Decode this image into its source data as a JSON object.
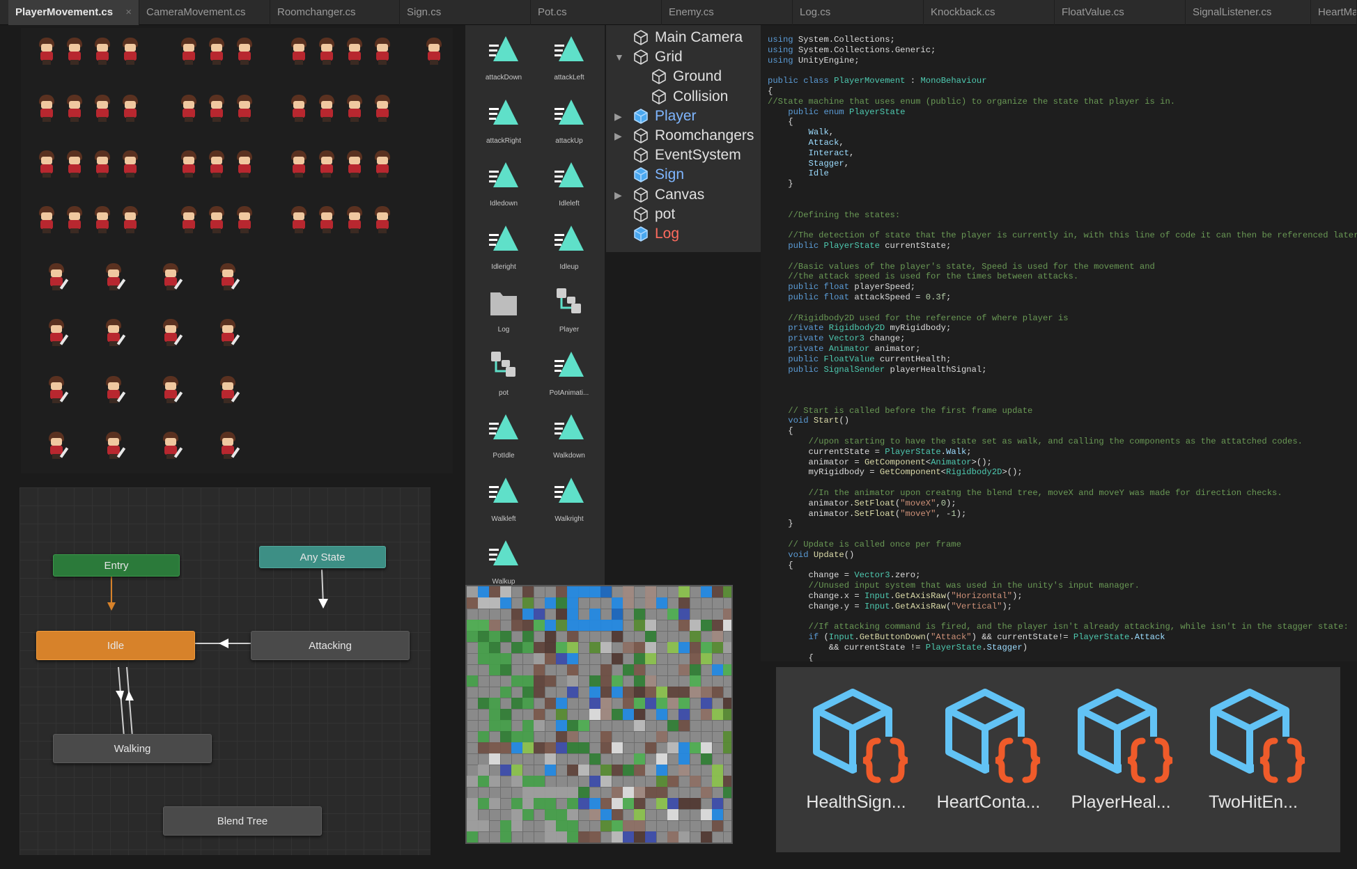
{
  "tabs": [
    {
      "label": "PlayerMovement.cs",
      "active": true,
      "close": "×"
    },
    {
      "label": "CameraMovement.cs"
    },
    {
      "label": "Roomchanger.cs"
    },
    {
      "label": "Sign.cs"
    },
    {
      "label": "Pot.cs"
    },
    {
      "label": "Enemy.cs"
    },
    {
      "label": "Log.cs"
    },
    {
      "label": "Knockback.cs"
    },
    {
      "label": "FloatValue.cs"
    },
    {
      "label": "SignalListener.cs"
    },
    {
      "label": "HeartMa"
    }
  ],
  "animator": {
    "entry": "Entry",
    "any_state": "Any State",
    "idle": "Idle",
    "attacking": "Attacking",
    "walking": "Walking",
    "blend_tree": "Blend Tree"
  },
  "assets": [
    {
      "label": "attackDown",
      "icon": "animation-clip-icon"
    },
    {
      "label": "attackLeft",
      "icon": "animation-clip-icon"
    },
    {
      "label": "attackRight",
      "icon": "animation-clip-icon"
    },
    {
      "label": "attackUp",
      "icon": "animation-clip-icon"
    },
    {
      "label": "Idledown",
      "icon": "animation-clip-icon"
    },
    {
      "label": "Idleleft",
      "icon": "animation-clip-icon"
    },
    {
      "label": "Idleright",
      "icon": "animation-clip-icon"
    },
    {
      "label": "Idleup",
      "icon": "animation-clip-icon"
    },
    {
      "label": "Log",
      "icon": "folder-icon"
    },
    {
      "label": "Player",
      "icon": "animator-controller-icon"
    },
    {
      "label": "pot",
      "icon": "animator-controller-icon"
    },
    {
      "label": "PotAnimati...",
      "icon": "animation-clip-icon"
    },
    {
      "label": "PotIdle",
      "icon": "animation-clip-icon"
    },
    {
      "label": "Walkdown",
      "icon": "animation-clip-icon"
    },
    {
      "label": "Walkleft",
      "icon": "animation-clip-icon"
    },
    {
      "label": "Walkright",
      "icon": "animation-clip-icon"
    },
    {
      "label": "Walkup",
      "icon": "animation-clip-icon"
    }
  ],
  "hierarchy": [
    {
      "label": "Main Camera",
      "indent": 0,
      "expand": "",
      "style": "normal"
    },
    {
      "label": "Grid",
      "indent": 0,
      "expand": "▼",
      "style": "normal"
    },
    {
      "label": "Ground",
      "indent": 1,
      "expand": "",
      "style": "normal"
    },
    {
      "label": "Collision",
      "indent": 1,
      "expand": "",
      "style": "normal"
    },
    {
      "label": "Player",
      "indent": 0,
      "expand": "▶",
      "style": "blue"
    },
    {
      "label": "Roomchangers",
      "indent": 0,
      "expand": "▶",
      "style": "normal"
    },
    {
      "label": "EventSystem",
      "indent": 0,
      "expand": "",
      "style": "normal"
    },
    {
      "label": "Sign",
      "indent": 0,
      "expand": "",
      "style": "blue"
    },
    {
      "label": "Canvas",
      "indent": 0,
      "expand": "▶",
      "style": "normal"
    },
    {
      "label": "pot",
      "indent": 0,
      "expand": "",
      "style": "normal"
    },
    {
      "label": "Log",
      "indent": 0,
      "expand": "",
      "style": "red"
    }
  ],
  "code": {
    "lines": [
      [
        [
          "k",
          "using"
        ],
        [
          "p",
          " System.Collections;"
        ]
      ],
      [
        [
          "k",
          "using"
        ],
        [
          "p",
          " System.Collections.Generic;"
        ]
      ],
      [
        [
          "k",
          "using"
        ],
        [
          "p",
          " UnityEngine;"
        ]
      ],
      [],
      [
        [
          "k",
          "public class "
        ],
        [
          "t",
          "PlayerMovement"
        ],
        [
          "p",
          " : "
        ],
        [
          "t",
          "MonoBehaviour"
        ]
      ],
      [
        [
          "p",
          "{"
        ]
      ],
      [
        [
          "c",
          "//State machine that uses enum (public) to organize the state that player is in."
        ]
      ],
      [
        [
          "p",
          "    "
        ],
        [
          "k",
          "public enum "
        ],
        [
          "t",
          "PlayerState"
        ]
      ],
      [
        [
          "p",
          "    {"
        ]
      ],
      [
        [
          "p",
          "        "
        ],
        [
          "v",
          "Walk"
        ],
        [
          "p",
          ","
        ]
      ],
      [
        [
          "p",
          "        "
        ],
        [
          "v",
          "Attack"
        ],
        [
          "p",
          ","
        ]
      ],
      [
        [
          "p",
          "        "
        ],
        [
          "v",
          "Interact"
        ],
        [
          "p",
          ","
        ]
      ],
      [
        [
          "p",
          "        "
        ],
        [
          "v",
          "Stagger"
        ],
        [
          "p",
          ","
        ]
      ],
      [
        [
          "p",
          "        "
        ],
        [
          "v",
          "Idle"
        ]
      ],
      [
        [
          "p",
          "    }"
        ]
      ],
      [],
      [],
      [
        [
          "p",
          "    "
        ],
        [
          "c",
          "//Defining the states:"
        ]
      ],
      [],
      [
        [
          "p",
          "    "
        ],
        [
          "c",
          "//The detection of state that the player is currently in, with this line of code it can then be referenced later."
        ]
      ],
      [
        [
          "p",
          "    "
        ],
        [
          "k",
          "public "
        ],
        [
          "t",
          "PlayerState"
        ],
        [
          "p",
          " currentState;"
        ]
      ],
      [],
      [
        [
          "p",
          "    "
        ],
        [
          "c",
          "//Basic values of the player's state, Speed is used for the movement and"
        ]
      ],
      [
        [
          "p",
          "    "
        ],
        [
          "c",
          "//the attack speed is used for the times between attacks."
        ]
      ],
      [
        [
          "p",
          "    "
        ],
        [
          "k",
          "public float"
        ],
        [
          "p",
          " playerSpeed;"
        ]
      ],
      [
        [
          "p",
          "    "
        ],
        [
          "k",
          "public float"
        ],
        [
          "p",
          " attackSpeed = "
        ],
        [
          "n",
          "0.3f"
        ],
        [
          "p",
          ";"
        ]
      ],
      [],
      [
        [
          "p",
          "    "
        ],
        [
          "c",
          "//Rigidbody2D used for the reference of where player is"
        ]
      ],
      [
        [
          "p",
          "    "
        ],
        [
          "k",
          "private "
        ],
        [
          "t",
          "Rigidbody2D"
        ],
        [
          "p",
          " myRigidbody;"
        ]
      ],
      [
        [
          "p",
          "    "
        ],
        [
          "k",
          "private "
        ],
        [
          "t",
          "Vector3"
        ],
        [
          "p",
          " change;"
        ]
      ],
      [
        [
          "p",
          "    "
        ],
        [
          "k",
          "private "
        ],
        [
          "t",
          "Animator"
        ],
        [
          "p",
          " animator;"
        ]
      ],
      [
        [
          "p",
          "    "
        ],
        [
          "k",
          "public "
        ],
        [
          "t",
          "FloatValue"
        ],
        [
          "p",
          " currentHealth;"
        ]
      ],
      [
        [
          "p",
          "    "
        ],
        [
          "k",
          "public "
        ],
        [
          "t",
          "SignalSender"
        ],
        [
          "p",
          " playerHealthSignal;"
        ]
      ],
      [],
      [],
      [],
      [
        [
          "p",
          "    "
        ],
        [
          "c",
          "// Start is called before the first frame update"
        ]
      ],
      [
        [
          "p",
          "    "
        ],
        [
          "k",
          "void "
        ],
        [
          "m",
          "Start"
        ],
        [
          "p",
          "()"
        ]
      ],
      [
        [
          "p",
          "    {"
        ]
      ],
      [
        [
          "p",
          "        "
        ],
        [
          "c",
          "//upon starting to have the state set as walk, and calling the components as the attatched codes."
        ]
      ],
      [
        [
          "p",
          "        currentState = "
        ],
        [
          "t",
          "PlayerState"
        ],
        [
          "p",
          "."
        ],
        [
          "v",
          "Walk"
        ],
        [
          "p",
          ";"
        ]
      ],
      [
        [
          "p",
          "        animator = "
        ],
        [
          "m",
          "GetComponent"
        ],
        [
          "p",
          "<"
        ],
        [
          "t",
          "Animator"
        ],
        [
          "p",
          ">();"
        ]
      ],
      [
        [
          "p",
          "        myRigidbody = "
        ],
        [
          "m",
          "GetComponent"
        ],
        [
          "p",
          "<"
        ],
        [
          "t",
          "Rigidbody2D"
        ],
        [
          "p",
          ">();"
        ]
      ],
      [],
      [
        [
          "p",
          "        "
        ],
        [
          "c",
          "//In the animator upon creatng the blend tree, moveX and moveY was made for direction checks."
        ]
      ],
      [
        [
          "p",
          "        animator."
        ],
        [
          "m",
          "SetFloat"
        ],
        [
          "p",
          "("
        ],
        [
          "s",
          "\"moveX\""
        ],
        [
          "p",
          ","
        ],
        [
          "n",
          "0"
        ],
        [
          "p",
          ");"
        ]
      ],
      [
        [
          "p",
          "        animator."
        ],
        [
          "m",
          "SetFloat"
        ],
        [
          "p",
          "("
        ],
        [
          "s",
          "\"moveY\""
        ],
        [
          "p",
          ", -"
        ],
        [
          "n",
          "1"
        ],
        [
          "p",
          ");"
        ]
      ],
      [
        [
          "p",
          "    }"
        ]
      ],
      [],
      [
        [
          "p",
          "    "
        ],
        [
          "c",
          "// Update is called once per frame"
        ]
      ],
      [
        [
          "p",
          "    "
        ],
        [
          "k",
          "void "
        ],
        [
          "m",
          "Update"
        ],
        [
          "p",
          "()"
        ]
      ],
      [
        [
          "p",
          "    {"
        ]
      ],
      [
        [
          "p",
          "        change = "
        ],
        [
          "t",
          "Vector3"
        ],
        [
          "p",
          ".zero;"
        ]
      ],
      [
        [
          "p",
          "        "
        ],
        [
          "c",
          "//Unused input system that was used in the unity's input manager."
        ]
      ],
      [
        [
          "p",
          "        change.x = "
        ],
        [
          "t",
          "Input"
        ],
        [
          "p",
          "."
        ],
        [
          "m",
          "GetAxisRaw"
        ],
        [
          "p",
          "("
        ],
        [
          "s",
          "\"Horizontal\""
        ],
        [
          "p",
          ");"
        ]
      ],
      [
        [
          "p",
          "        change.y = "
        ],
        [
          "t",
          "Input"
        ],
        [
          "p",
          "."
        ],
        [
          "m",
          "GetAxisRaw"
        ],
        [
          "p",
          "("
        ],
        [
          "s",
          "\"Vertical\""
        ],
        [
          "p",
          ");"
        ]
      ],
      [],
      [
        [
          "p",
          "        "
        ],
        [
          "c",
          "//If attacking command is fired, and the player isn't already attacking, while isn't in the stagger state:"
        ]
      ],
      [
        [
          "p",
          "        "
        ],
        [
          "k",
          "if"
        ],
        [
          "p",
          " ("
        ],
        [
          "t",
          "Input"
        ],
        [
          "p",
          "."
        ],
        [
          "m",
          "GetButtonDown"
        ],
        [
          "p",
          "("
        ],
        [
          "s",
          "\"Attack\""
        ],
        [
          "p",
          ") && currentState!= "
        ],
        [
          "t",
          "PlayerState"
        ],
        [
          "p",
          "."
        ],
        [
          "v",
          "Attack"
        ]
      ],
      [
        [
          "p",
          "            && currentState != "
        ],
        [
          "t",
          "PlayerState"
        ],
        [
          "p",
          "."
        ],
        [
          "v",
          "Stagger"
        ],
        [
          "p",
          ")"
        ]
      ],
      [
        [
          "p",
          "        {"
        ]
      ]
    ]
  },
  "scripts": [
    {
      "label": "HealthSign...",
      "icon": "script-icon"
    },
    {
      "label": "HeartConta...",
      "icon": "script-icon"
    },
    {
      "label": "PlayerHeal...",
      "icon": "script-icon"
    },
    {
      "label": "TwoHitEn...",
      "icon": "script-icon"
    }
  ],
  "colors": {
    "clip_accent": "#5fe0c9",
    "script_cube": "#62c3f5",
    "script_braces": "#ef5b2a",
    "idle_state": "#d7822a",
    "entry_state": "#2b7a3a",
    "any_state": "#3d8f85"
  }
}
